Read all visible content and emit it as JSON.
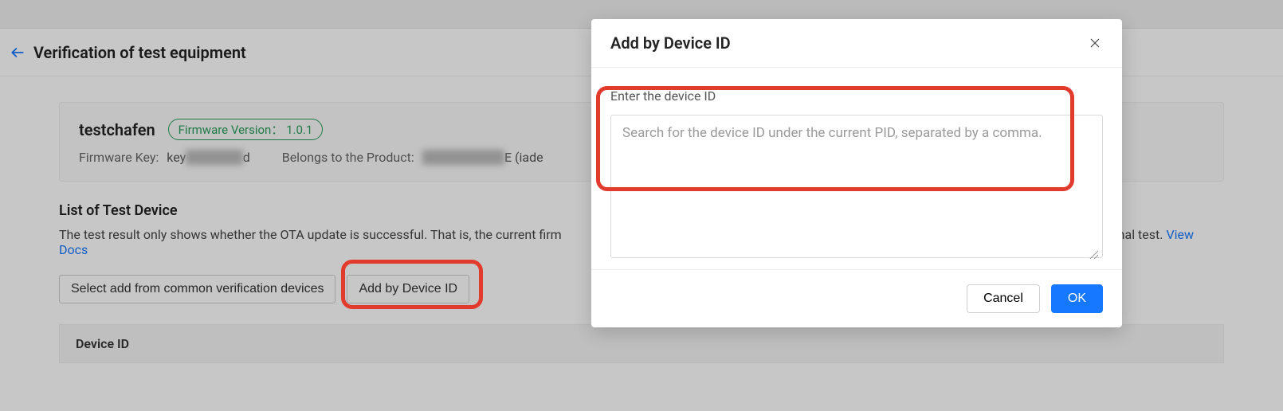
{
  "header": {
    "title": "Verification of test equipment"
  },
  "info": {
    "product_name": "testchafen",
    "fw_badge_label": "Firmware Version：",
    "fw_version": "1.0.1",
    "firmware_key_label": "Firmware Key:",
    "firmware_key_prefix": "key",
    "firmware_key_hidden": "xxxxxxxx",
    "firmware_key_suffix": "d",
    "belongs_label": "Belongs to the Product:",
    "belongs_hidden": "xxxxxxxxxxxx",
    "belongs_suffix": "E (iade"
  },
  "section": {
    "title": "List of Test Device",
    "desc_prefix": "The test result only shows whether the OTA update is successful. That is, the current firm",
    "desc_suffix": "nal test.",
    "view_docs": "View Docs"
  },
  "buttons": {
    "select_common": "Select add from common verification devices",
    "add_by_device": "Add by Device ID"
  },
  "table": {
    "col_device_id": "Device ID"
  },
  "modal": {
    "title": "Add by Device ID",
    "field_label": "Enter the device ID",
    "placeholder": "Search for the device ID under the current PID, separated by a comma.",
    "cancel": "Cancel",
    "ok": "OK"
  }
}
